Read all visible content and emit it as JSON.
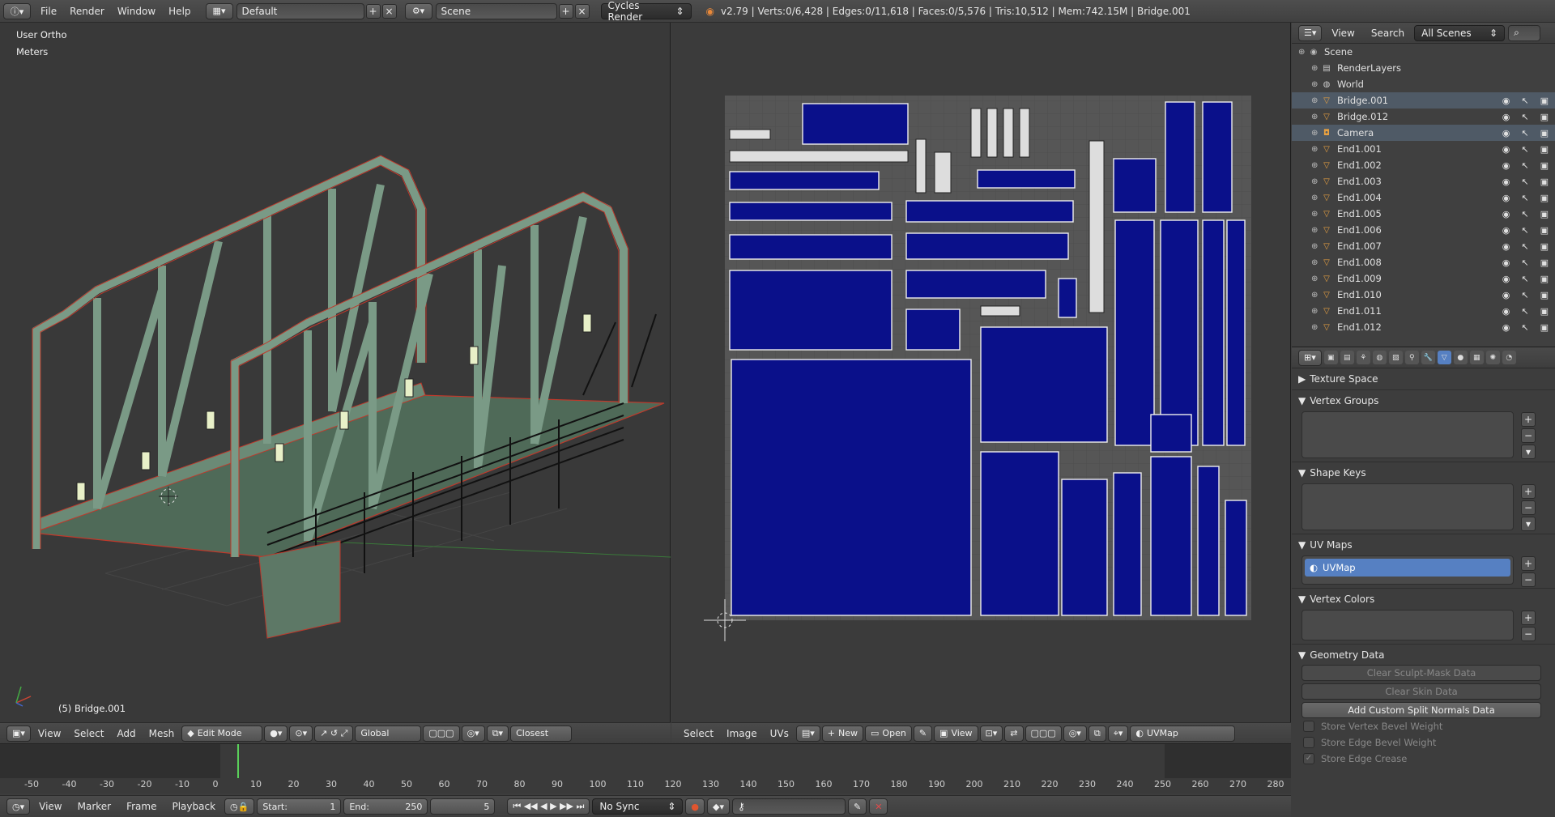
{
  "topbar": {
    "menus": [
      "File",
      "Render",
      "Window",
      "Help"
    ],
    "layout": "Default",
    "scene": "Scene",
    "engine": "Cycles Render",
    "stats": "v2.79 | Verts:0/6,428 | Edges:0/11,618 | Faces:0/5,576 | Tris:10,512 | Mem:742.15M | Bridge.001"
  },
  "viewport3d": {
    "view_label": "User Ortho",
    "units_label": "Meters",
    "object_label": "(5) Bridge.001",
    "header": {
      "menus": [
        "View",
        "Select",
        "Add",
        "Mesh"
      ],
      "mode": "Edit Mode",
      "orientation": "Global",
      "snap": "Closest"
    }
  },
  "uv_editor": {
    "header": {
      "menus": [
        "Select",
        "Image",
        "UVs"
      ],
      "new_label": "New",
      "open_label": "Open",
      "view_label": "View",
      "uvmap": "UVMap"
    }
  },
  "timeline": {
    "ticks": [
      "-50",
      "-40",
      "-30",
      "-20",
      "-10",
      "0",
      "10",
      "20",
      "30",
      "40",
      "50",
      "60",
      "70",
      "80",
      "90",
      "100",
      "110",
      "120",
      "130",
      "140",
      "150",
      "160",
      "170",
      "180",
      "190",
      "200",
      "210",
      "220",
      "230",
      "240",
      "250",
      "260",
      "270",
      "280"
    ],
    "menus": [
      "View",
      "Marker",
      "Frame",
      "Playback"
    ],
    "start_label": "Start:",
    "start_value": "1",
    "end_label": "End:",
    "end_value": "250",
    "current_frame": "5",
    "sync": "No Sync"
  },
  "outliner": {
    "menus": [
      "View",
      "Search"
    ],
    "filter": "All Scenes",
    "items": [
      {
        "name": "Scene",
        "type": "scene",
        "indent": 0
      },
      {
        "name": "RenderLayers",
        "type": "renderlayers",
        "indent": 1
      },
      {
        "name": "World",
        "type": "world",
        "indent": 1
      },
      {
        "name": "Bridge.001",
        "type": "mesh",
        "indent": 1,
        "selected": true
      },
      {
        "name": "Bridge.012",
        "type": "mesh",
        "indent": 1
      },
      {
        "name": "Camera",
        "type": "camera",
        "indent": 1,
        "selected": true
      },
      {
        "name": "End1.001",
        "type": "mesh",
        "indent": 1
      },
      {
        "name": "End1.002",
        "type": "mesh",
        "indent": 1
      },
      {
        "name": "End1.003",
        "type": "mesh",
        "indent": 1
      },
      {
        "name": "End1.004",
        "type": "mesh",
        "indent": 1
      },
      {
        "name": "End1.005",
        "type": "mesh",
        "indent": 1
      },
      {
        "name": "End1.006",
        "type": "mesh",
        "indent": 1
      },
      {
        "name": "End1.007",
        "type": "mesh",
        "indent": 1
      },
      {
        "name": "End1.008",
        "type": "mesh",
        "indent": 1
      },
      {
        "name": "End1.009",
        "type": "mesh",
        "indent": 1
      },
      {
        "name": "End1.010",
        "type": "mesh",
        "indent": 1
      },
      {
        "name": "End1.011",
        "type": "mesh",
        "indent": 1
      },
      {
        "name": "End1.012",
        "type": "mesh",
        "indent": 1
      }
    ]
  },
  "properties": {
    "texture_space": "Texture Space",
    "vertex_groups": "Vertex Groups",
    "shape_keys": "Shape Keys",
    "uv_maps": "UV Maps",
    "uvmap_item": "UVMap",
    "vertex_colors": "Vertex Colors",
    "geometry_data": "Geometry Data",
    "clear_sculpt": "Clear Sculpt-Mask Data",
    "clear_skin": "Clear Skin Data",
    "add_normals": "Add Custom Split Normals Data",
    "store_vbw": "Store Vertex Bevel Weight",
    "store_ebw": "Store Edge Bevel Weight",
    "store_crease": "Store Edge Crease"
  },
  "colors": {
    "uv_island": "#0a108a",
    "mesh_face": "#5e7a68",
    "selection": "#5680c2"
  }
}
